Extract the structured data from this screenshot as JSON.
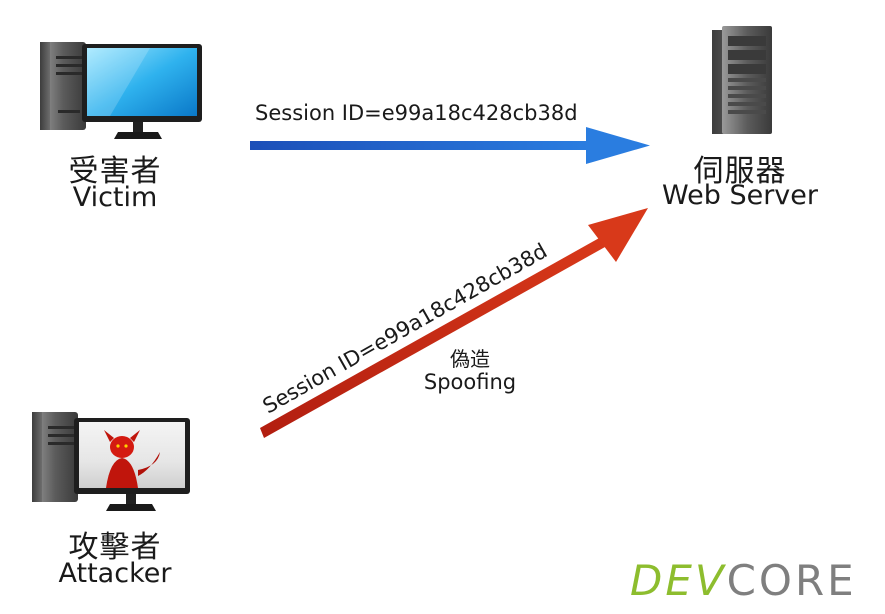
{
  "victim": {
    "name_zh": "受害者",
    "name_en": "Victim"
  },
  "server": {
    "name_zh": "伺服器",
    "name_en": "Web Server"
  },
  "attacker": {
    "name_zh": "攻擊者",
    "name_en": "Attacker"
  },
  "victim_request": {
    "label": "Session ID=e99a18c428cb38d",
    "color": "#1f5fcf"
  },
  "attacker_request": {
    "label": "Session ID=e99a18c428cb38d",
    "color": "#c42a12",
    "note_zh": "偽造",
    "note_en": "Spoofing"
  },
  "logo": {
    "part1": "DEV",
    "part2": "CORE",
    "color1": "#8dbd2e",
    "color2": "#7f7f7f"
  }
}
